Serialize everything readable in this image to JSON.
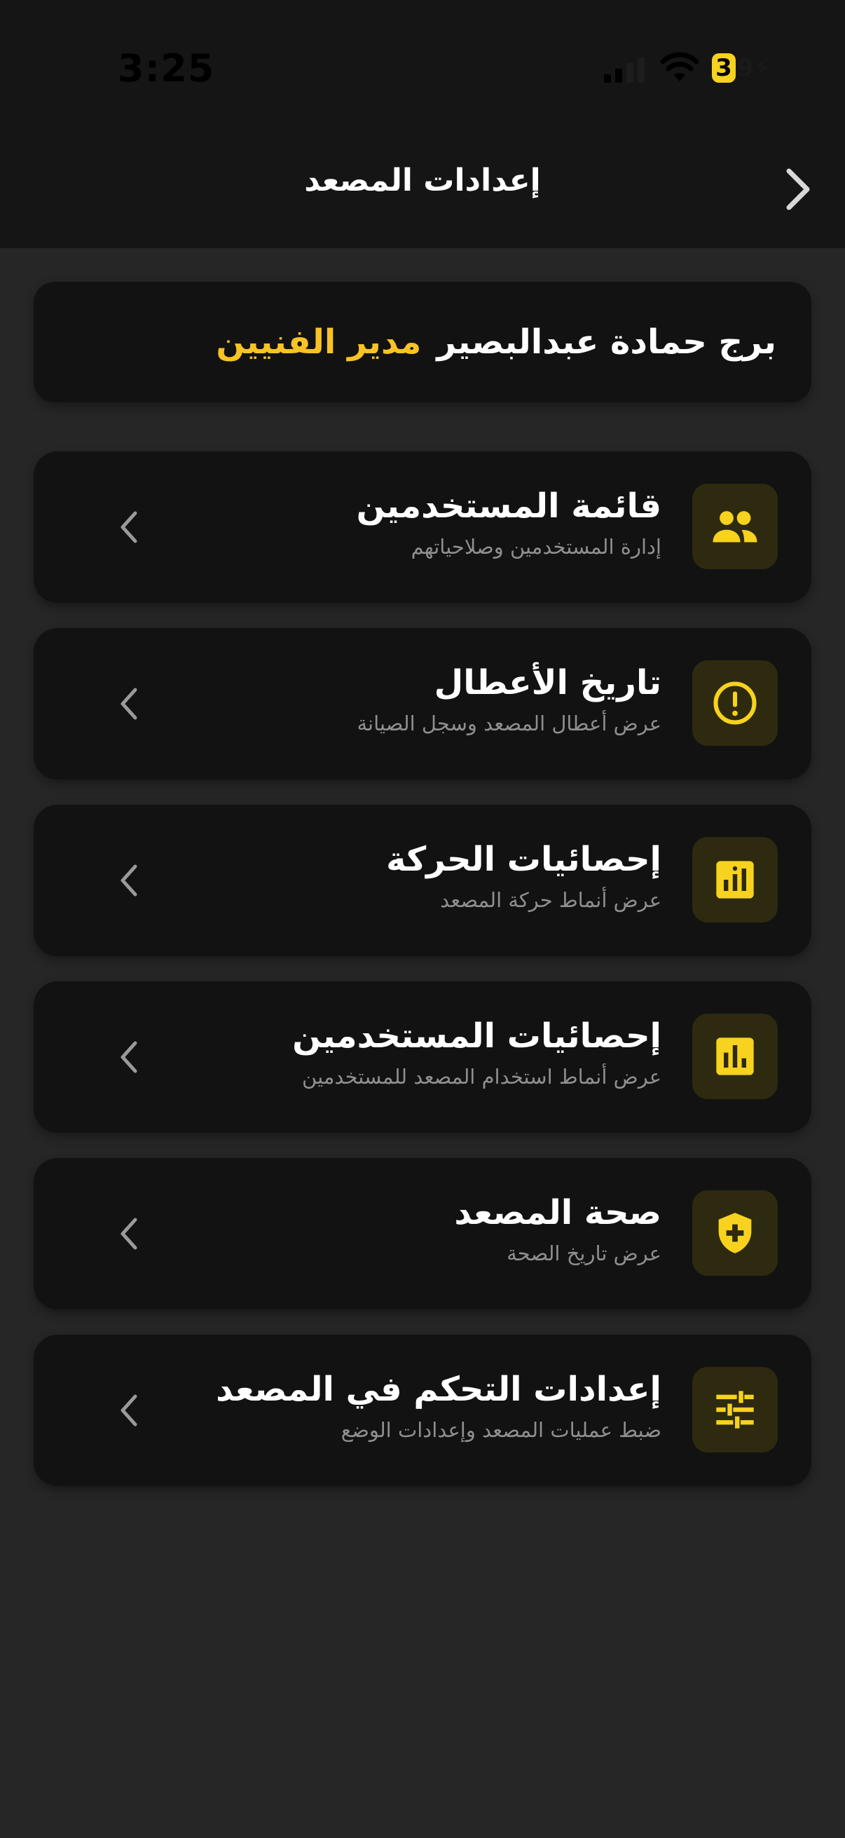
{
  "status_bar": {
    "time": "3:25",
    "battery_level": "3",
    "battery_rest": "9⚡"
  },
  "nav": {
    "title": "إعدادات المصعد",
    "back_icon": "chevron-right-icon"
  },
  "user": {
    "name": "برج حمادة عبدالبصير",
    "role": "مدير الفنيين"
  },
  "menu": [
    {
      "title": "قائمة المستخدمين",
      "subtitle": "إدارة المستخدمين وصلاحياتهم",
      "icon": "group-icon"
    },
    {
      "title": "تاريخ الأعطال",
      "subtitle": "عرض أعطال المصعد وسجل الصيانة",
      "icon": "alert-circle-icon"
    },
    {
      "title": "إحصائيات الحركة",
      "subtitle": "عرض أنماط حركة المصعد",
      "icon": "insights-icon"
    },
    {
      "title": "إحصائيات المستخدمين",
      "subtitle": "عرض أنماط استخدام المصعد للمستخدمين",
      "icon": "bar-chart-icon"
    },
    {
      "title": "صحة المصعد",
      "subtitle": "عرض تاريخ الصحة",
      "icon": "health-shield-icon"
    },
    {
      "title": "إعدادات التحكم في المصعد",
      "subtitle": "ضبط عمليات المصعد وإعدادات الوضع",
      "icon": "tune-icon"
    }
  ],
  "colors": {
    "accent": "#f7d21e",
    "role_text": "#f7c325",
    "icon_tile": "#2d2a10",
    "card": "#121212",
    "background": "#262626",
    "header": "#151515",
    "subtitle": "#8f8f8f"
  }
}
